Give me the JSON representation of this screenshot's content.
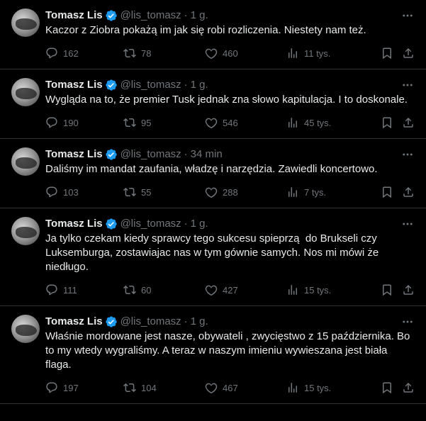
{
  "icons": {
    "reply": "reply-icon",
    "retweet": "retweet-icon",
    "like": "heart-icon",
    "views": "views-chart-icon",
    "bookmark": "bookmark-icon",
    "share": "share-icon",
    "more": "more-icon",
    "verified": "verified-badge-icon"
  },
  "colors": {
    "background": "#000000",
    "text": "#e7e9ea",
    "muted": "#71767b",
    "verified": "#1d9bf0",
    "divider": "#2f3336"
  },
  "tweets": [
    {
      "name": "Tomasz Lis",
      "handle": "@lis_tomasz",
      "sep": "·",
      "time": "1 g.",
      "text": "Kaczor z Ziobra pokażą im jak się robi rozliczenia. Niestety nam też.",
      "replies": "162",
      "retweets": "78",
      "likes": "460",
      "views": "11 tys."
    },
    {
      "name": "Tomasz Lis",
      "handle": "@lis_tomasz",
      "sep": "·",
      "time": "1 g.",
      "text": "Wygląda na to, że premier Tusk jednak zna słowo kapitulacja. I to doskonale.",
      "replies": "190",
      "retweets": "95",
      "likes": "546",
      "views": "45 tys."
    },
    {
      "name": "Tomasz Lis",
      "handle": "@lis_tomasz",
      "sep": "·",
      "time": "34 min",
      "text": "Daliśmy im mandat zaufania, władzę i narzędzia. Zawiedli koncertowo.",
      "replies": "103",
      "retweets": "55",
      "likes": "288",
      "views": "7 tys."
    },
    {
      "name": "Tomasz Lis",
      "handle": "@lis_tomasz",
      "sep": "·",
      "time": "1 g.",
      "text": "Ja tylko czekam kiedy sprawcy tego sukcesu spieprzą  do Brukseli czy Luksemburga, zostawiajac nas w tym gównie samych. Nos mi mówi że niedługo.",
      "replies": "111",
      "retweets": "60",
      "likes": "427",
      "views": "15 tys."
    },
    {
      "name": "Tomasz Lis",
      "handle": "@lis_tomasz",
      "sep": "·",
      "time": "1 g.",
      "text": "Właśnie mordowane jest nasze, obywateli , zwycięstwo z 15 października. Bo to my wtedy wygraliśmy. A teraz w naszym imieniu wywieszana jest biała flaga.",
      "replies": "197",
      "retweets": "104",
      "likes": "467",
      "views": "15 tys."
    }
  ]
}
